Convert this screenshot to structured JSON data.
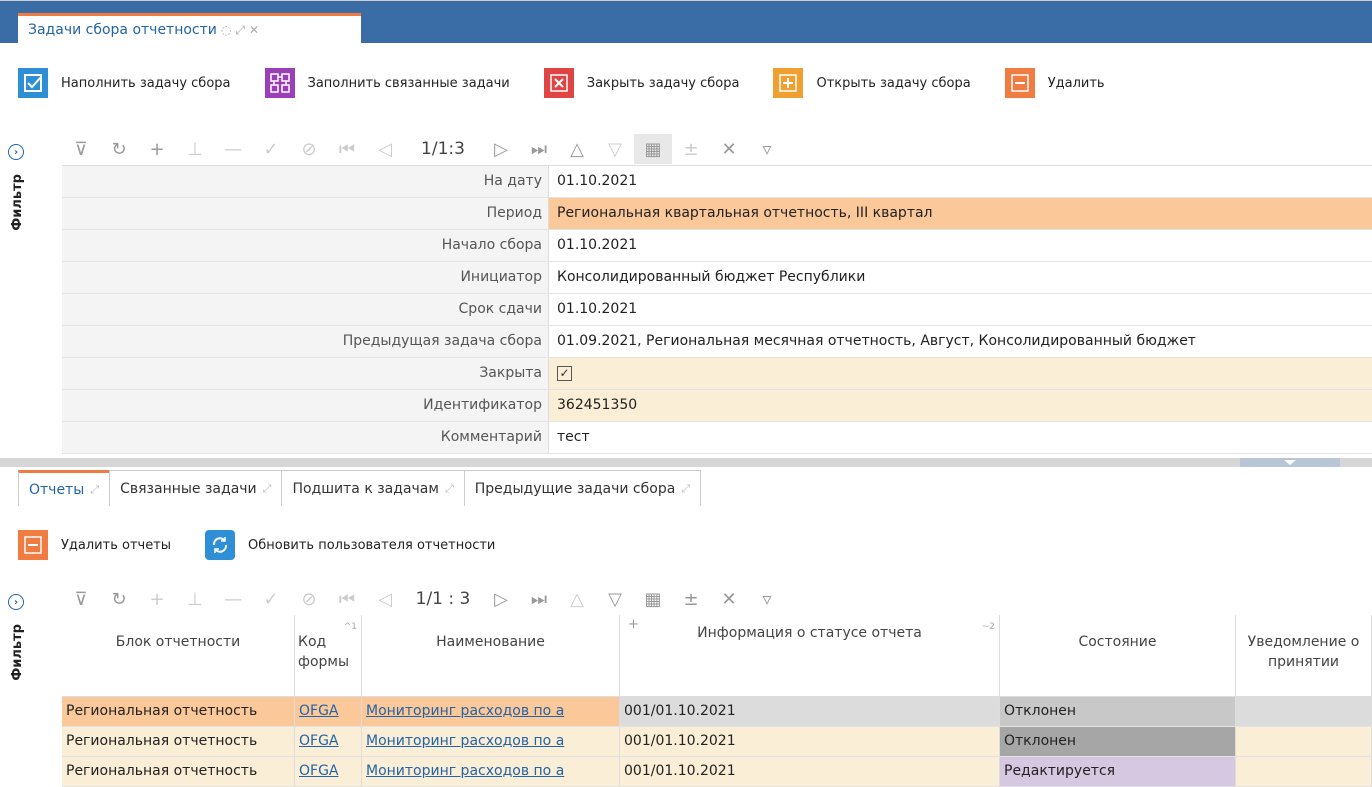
{
  "window_tab": {
    "title": "Задачи сбора отчетности"
  },
  "top_actions": [
    {
      "label": "Наполнить задачу сбора",
      "icon": "checkmark-box-icon",
      "color": "#2e8fd6"
    },
    {
      "label": "Заполнить связанные задачи",
      "icon": "linked-tasks-icon",
      "color": "#9b3fb8"
    },
    {
      "label": "Закрыть задачу сбора",
      "icon": "close-box-icon",
      "color": "#e04545"
    },
    {
      "label": "Открыть задачу сбора",
      "icon": "plus-box-icon",
      "color": "#f0a030"
    },
    {
      "label": "Удалить",
      "icon": "minus-box-icon",
      "color": "#f07c42"
    }
  ],
  "side_panel": {
    "filter_label": "Фильтр"
  },
  "pager_top": "1/1:3",
  "pager_bottom": "1/1 : 3",
  "form": {
    "rows": [
      {
        "label": "На дату",
        "value": "01.10.2021"
      },
      {
        "label": "Период",
        "value": "Региональная квартальная отчетность, III квартал"
      },
      {
        "label": "Начало сбора",
        "value": "01.10.2021"
      },
      {
        "label": "Инициатор",
        "value": "Консолидированный бюджет Республики"
      },
      {
        "label": "Срок сдачи",
        "value": "01.10.2021"
      },
      {
        "label": "Предыдущая задача сбора",
        "value": "01.09.2021, Региональная месячная отчетность, Август, Консолидированный бюджет"
      },
      {
        "label": "Закрыта",
        "value": ""
      },
      {
        "label": "Идентификатор",
        "value": "362451350"
      },
      {
        "label": "Комментарий",
        "value": "тест"
      }
    ]
  },
  "bottom_tabs": [
    {
      "label": "Отчеты"
    },
    {
      "label": "Связанные задачи"
    },
    {
      "label": "Подшита к задачам"
    },
    {
      "label": "Предыдущие задачи сбора"
    }
  ],
  "bottom_actions": [
    {
      "label": "Удалить отчеты",
      "icon": "minus-box-icon",
      "color": "#f07c42"
    },
    {
      "label": "Обновить пользователя отчетности",
      "icon": "refresh-icon",
      "color": "#2e8fd6"
    }
  ],
  "grid": {
    "columns": [
      {
        "label": "Блок отчетности"
      },
      {
        "label": "Код формы"
      },
      {
        "label": "Наименование"
      },
      {
        "label": "Информация о статусе отчета"
      },
      {
        "label": "Состояние"
      },
      {
        "label": "Уведомление о принятии"
      }
    ],
    "sort_marks": {
      "code": "^1",
      "info": "~2",
      "info_plus": "+"
    },
    "rows": [
      {
        "block": "Региональная отчетность",
        "code": "OFGA",
        "name": "Мониторинг расходов по а",
        "info": "001/01.10.2021",
        "state": "Отклонен",
        "state_color": "#c8c8c8",
        "notice": ""
      },
      {
        "block": "Региональная отчетность",
        "code": "OFGA",
        "name": "Мониторинг расходов по а",
        "info": "001/01.10.2021",
        "state": "Отклонен",
        "state_color": "#a6a6a6",
        "notice": ""
      },
      {
        "block": "Региональная отчетность",
        "code": "OFGA",
        "name": "Мониторинг расходов по а",
        "info": "001/01.10.2021",
        "state": "Редактируется",
        "state_color": "#d6c8e0",
        "notice": ""
      }
    ]
  },
  "colors": {
    "accent": "#2364a6",
    "header_bar": "#3a6ca6",
    "orange_row": "#fbc89a",
    "cream_row": "#fbeed6"
  }
}
